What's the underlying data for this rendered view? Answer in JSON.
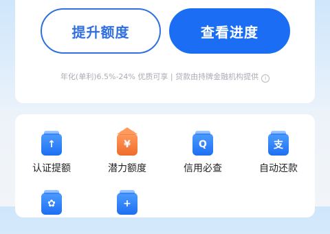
{
  "actions": {
    "increase_limit_label": "提升额度",
    "view_progress_label": "查看进度"
  },
  "disclaimer": {
    "text": "年化(单利)6.5%-24% 优质可享 | 贷款由持牌金融机构提供",
    "info_glyph": "i"
  },
  "services": [
    {
      "label": "认证提额",
      "icon": "arrow-up-icon",
      "glyph": "↑",
      "color": "#1d6ff2"
    },
    {
      "label": "潜力额度",
      "icon": "yuan-house-icon",
      "glyph": "¥",
      "color": "#f06b2a"
    },
    {
      "label": "信用必查",
      "icon": "search-icon",
      "glyph": "Q",
      "color": "#1d6ff2"
    },
    {
      "label": "自动还款",
      "icon": "alipay-icon",
      "glyph": "支",
      "color": "#1d6ff2"
    },
    {
      "label": "",
      "icon": "star-icon",
      "glyph": "✿",
      "color": "#1d6ff2"
    },
    {
      "label": "",
      "icon": "plus-icon",
      "glyph": "+",
      "color": "#1d6ff2"
    }
  ],
  "colors": {
    "primary": "#1b6ef3",
    "outline": "#2f6fe0",
    "accent_orange": "#f06b2a"
  }
}
